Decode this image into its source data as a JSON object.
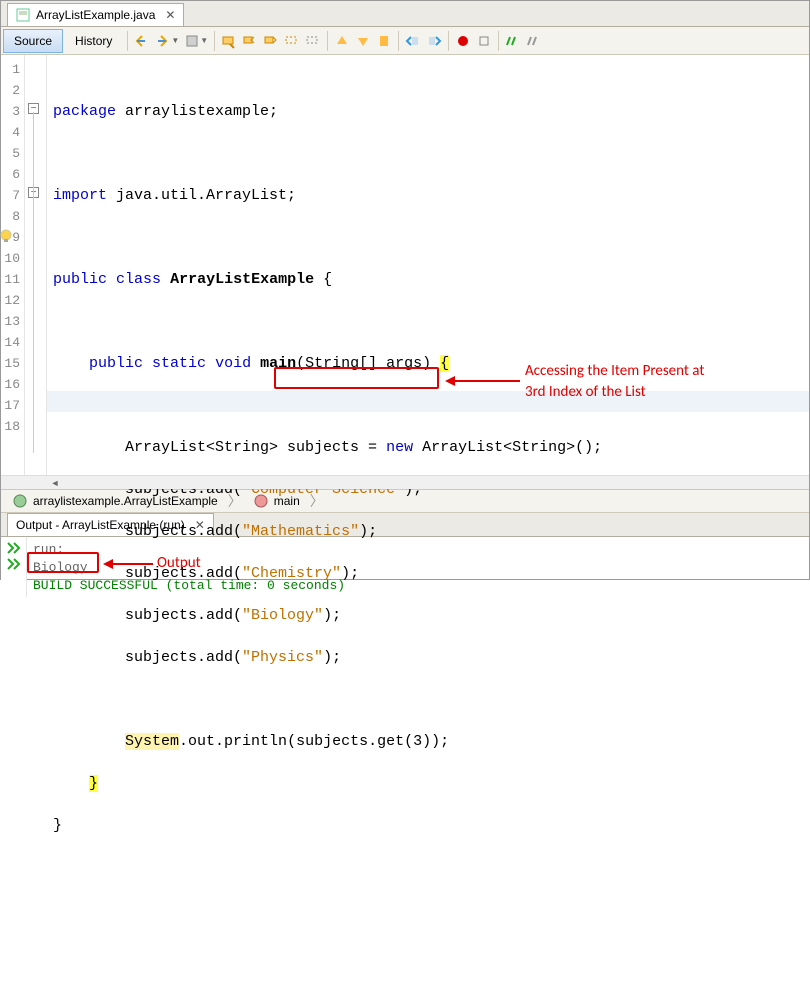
{
  "file_tab": {
    "label": "ArrayListExample.java"
  },
  "toolbar": {
    "source": "Source",
    "history": "History"
  },
  "lines": [
    "1",
    "2",
    "3",
    "4",
    "5",
    "6",
    "7",
    "8",
    "9",
    "10",
    "11",
    "12",
    "13",
    "14",
    "15",
    "16",
    "17",
    "18"
  ],
  "code": {
    "l1_kw": "package",
    "l1_rest": " arraylistexample;",
    "l3_kw": "import",
    "l3_rest": " java.util.ArrayList;",
    "l5_kw1": "public",
    "l5_kw2": "class",
    "l5_name": "ArrayListExample",
    "l5_brace": " {",
    "l7_kw1": "public",
    "l7_kw2": "static",
    "l7_kw3": "void",
    "l7_name": "main",
    "l7_args": "(String[] args) ",
    "l7_brace": "{",
    "l9_txt": "ArrayList<String> subjects = ",
    "l9_kw": "new",
    "l9_rest": " ArrayList<String>();",
    "l10_a": "subjects.add(",
    "l10_s": "\"Computer Science\"",
    "l10_b": ");",
    "l11_a": "subjects.add(",
    "l11_s": "\"Mathematics\"",
    "l11_b": ");",
    "l12_a": "subjects.add(",
    "l12_s": "\"Chemistry\"",
    "l12_b": ");",
    "l13_a": "subjects.add(",
    "l13_s": "\"Biology\"",
    "l13_b": ");",
    "l14_a": "subjects.add(",
    "l14_s": "\"Physics\"",
    "l14_b": ");",
    "l16_a": "System",
    "l16_b": ".out.println",
    "l16_c": "(subjects.get(3))",
    "l16_d": ";",
    "l17_brace": "}",
    "l18_brace": "}"
  },
  "annotation1": "Accessing the Item Present at\n3rd Index of the List",
  "annotation2": "Output",
  "breadcrumb": {
    "class": "arraylistexample.ArrayListExample",
    "method": "main"
  },
  "output": {
    "tab": "Output - ArrayListExample (run)",
    "run_label": "run:",
    "result": "Biology",
    "build": "BUILD SUCCESSFUL (total time: 0 seconds)"
  }
}
